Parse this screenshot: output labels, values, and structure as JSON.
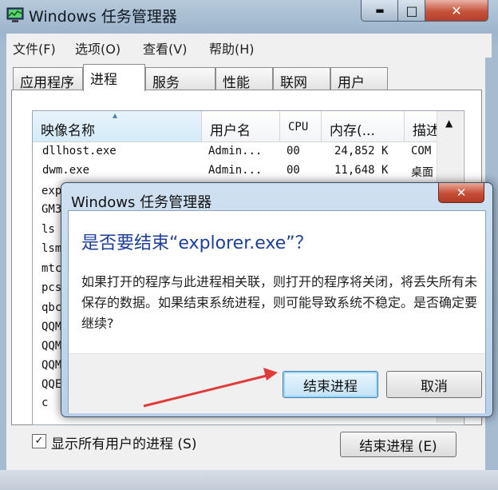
{
  "window": {
    "title": "Windows 任务管理器",
    "controls": {
      "minimize": "▬",
      "maximize": "□",
      "close": "✕"
    }
  },
  "menu": [
    "文件(F)",
    "选项(O)",
    "查看(V)",
    "帮助(H)"
  ],
  "tabs": [
    "应用程序",
    "进程",
    "服务",
    "性能",
    "联网",
    "用户"
  ],
  "active_tab": "进程",
  "columns": {
    "name": "映像名称",
    "user": "用户名",
    "cpu": "CPU",
    "memory": "内存(...",
    "desc": "描述"
  },
  "rows": [
    {
      "name": "dllhost.exe",
      "user": "Admin...",
      "cpu": "00",
      "memory": "24,852 K",
      "desc": "COM"
    },
    {
      "name": "dwm.exe",
      "user": "Admin...",
      "cpu": "00",
      "memory": "11,648 K",
      "desc": "桌面"
    }
  ],
  "partial_rows": [
    "exp",
    "GM3",
    "ls",
    "lsm",
    "mtc",
    "pcs",
    "qbc",
    "QQM",
    "QQM",
    "QQM",
    "QQE",
    "c"
  ],
  "show_all_users": {
    "label": "显示所有用户的进程",
    "shortcut": "(S)",
    "checked": "✓"
  },
  "end_process_button": "结束进程 (E)",
  "dialog": {
    "title": "Windows 任务管理器",
    "heading": "是否要结束“explorer.exe”？",
    "message": "如果打开的程序与此进程相关联，则打开的程序将关闭，将丢失所有未保存的数据。如果结束系统进程，则可能导致系统不稳定。是否确定要继续?",
    "confirm": "结束进程",
    "cancel": "取消",
    "close_glyph": "✕"
  },
  "colors": {
    "heading": "#1d3f9a",
    "arrow": "#e03a3a",
    "close_red": "#c64d35"
  }
}
